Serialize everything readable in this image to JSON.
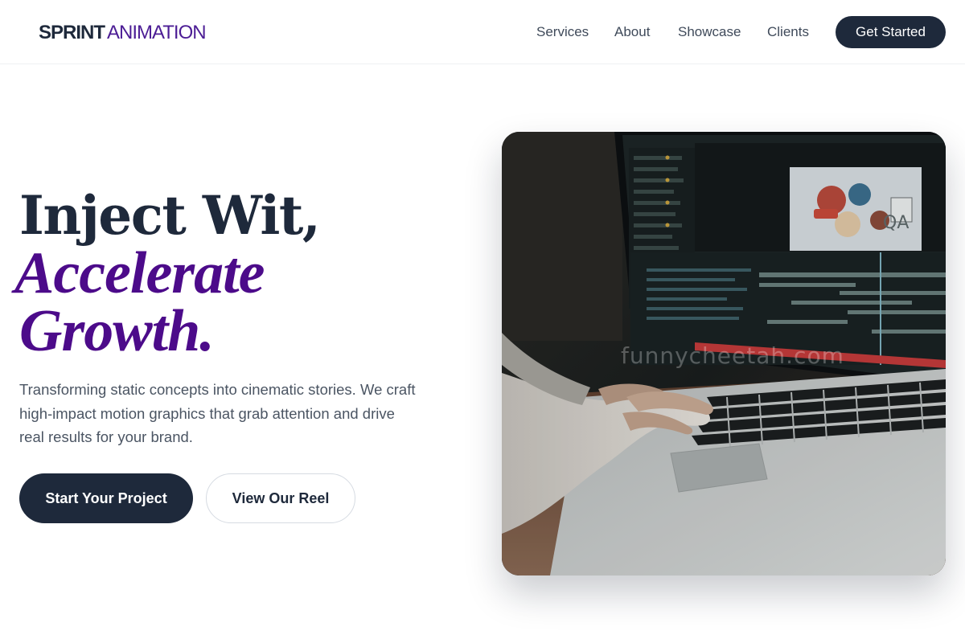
{
  "header": {
    "logo_primary": "SPRINT",
    "logo_secondary": "ANIMATION",
    "nav": [
      "Services",
      "About",
      "Showcase",
      "Clients"
    ],
    "cta_label": "Get Started"
  },
  "hero": {
    "headline_line1": "Inject Wit,",
    "headline_line2": "Accelerate",
    "headline_line3": "Growth.",
    "subtitle": "Transforming static concepts into cinematic stories. We craft high-impact motion graphics that grab attention and drive real results for your brand.",
    "primary_button": "Start Your Project",
    "secondary_button": "View Our Reel",
    "image_watermark": "funnycheetah.com",
    "screen_label": "QA"
  },
  "colors": {
    "dark_navy": "#1e293b",
    "accent_purple": "#4c0b8a",
    "body_text": "#4b5563"
  }
}
